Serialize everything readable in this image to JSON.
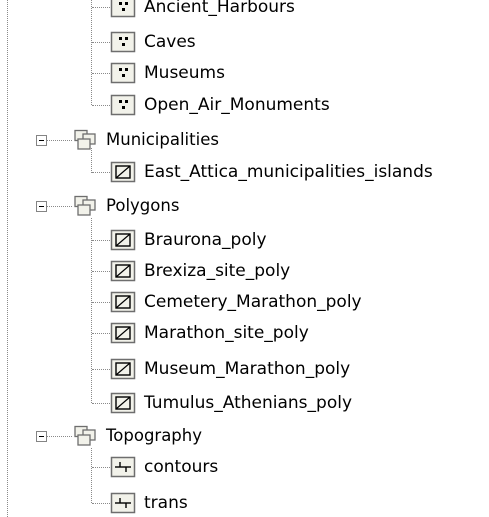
{
  "icons": {
    "point_layer": "point-layer-icon",
    "polygon_layer": "polygon-layer-icon",
    "line_layer": "line-layer-icon",
    "group_layer": "group-layer-icon",
    "collapse": "collapse-toggle-icon"
  },
  "colors": {
    "icon_fill": "#f2f2ea",
    "icon_border": "#6e6e6e",
    "tree_line": "#8a8a8a"
  },
  "tree": {
    "points": [
      {
        "label": "Ancient_Harbours"
      },
      {
        "label": "Caves"
      },
      {
        "label": "Museums"
      },
      {
        "label": "Open_Air_Monuments"
      }
    ],
    "municipalities": {
      "label": "Municipalities",
      "children": [
        {
          "label": "East_Attica_municipalities_islands"
        }
      ]
    },
    "polygons": {
      "label": "Polygons",
      "children": [
        {
          "label": "Braurona_poly"
        },
        {
          "label": "Brexiza_site_poly"
        },
        {
          "label": "Cemetery_Marathon_poly"
        },
        {
          "label": "Marathon_site_poly"
        },
        {
          "label": "Museum_Marathon_poly"
        },
        {
          "label": "Tumulus_Athenians_poly"
        }
      ]
    },
    "topography": {
      "label": "Topography",
      "children": [
        {
          "label": "contours"
        },
        {
          "label": "trans"
        }
      ]
    }
  }
}
